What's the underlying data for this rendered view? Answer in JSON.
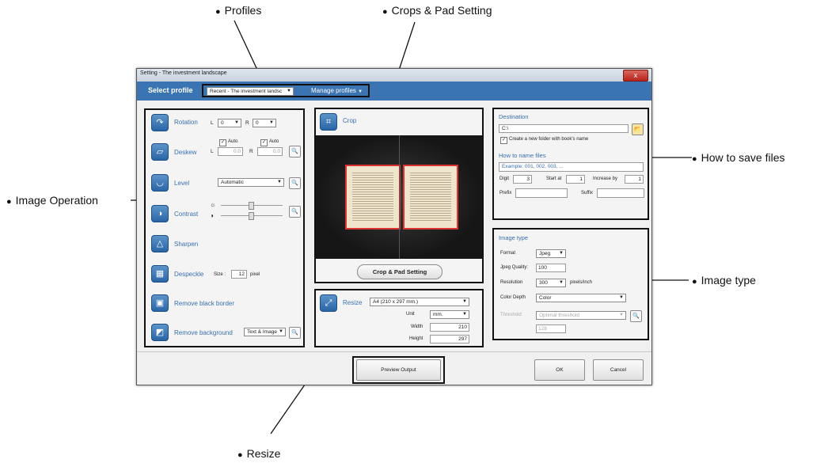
{
  "annotations": {
    "profiles": "Profiles",
    "crops_pad": "Crops & Pad Setting",
    "how_to_save": "How to save files",
    "image_operation": "Image Operation",
    "image_type": "Image type",
    "resize": "Resize"
  },
  "window": {
    "title": "Setting - The investment landscape",
    "close": "x"
  },
  "profile_bar": {
    "label": "Select profile",
    "selected": "Recent - The investment landsc",
    "manage": "Manage profiles"
  },
  "operations": {
    "rotation": {
      "label": "Rotation",
      "l_label": "L",
      "l_value": "0",
      "r_label": "R",
      "r_value": "0"
    },
    "deskew": {
      "label": "Deskew",
      "auto1": "Auto",
      "auto2": "Auto",
      "l_label": "L",
      "l_value": "0.0",
      "r_label": "R",
      "r_value": "0.0"
    },
    "level": {
      "label": "Level",
      "value": "Automatic"
    },
    "contrast": {
      "label": "Contrast"
    },
    "sharpen": {
      "label": "Sharpen"
    },
    "despeckle": {
      "label": "Despeckle",
      "size_label": "Size :",
      "size_value": "12",
      "unit": "pixel"
    },
    "remove_black_border": {
      "label": "Remove black border"
    },
    "remove_background": {
      "label": "Remove background",
      "value": "Text & Image"
    }
  },
  "crop": {
    "label": "Crop",
    "button": "Crop & Pad Setting"
  },
  "resize": {
    "label": "Resize",
    "preset": "A4 (210 x 297 mm.)",
    "unit_label": "Unit",
    "unit_value": "mm.",
    "width_label": "Width",
    "width_value": "210",
    "height_label": "Height",
    "height_value": "297"
  },
  "destination": {
    "title": "Destination",
    "path": "C:\\",
    "checkbox": "Create a new folder with book's name",
    "naming_title": "How to name files",
    "example": "Example: 001, 002, 003, ...",
    "digit_label": "Digit",
    "digit_value": "3",
    "start_label": "Start at",
    "start_value": "1",
    "increase_label": "Increase by",
    "increase_value": "1",
    "prefix_label": "Prefix",
    "suffix_label": "Suffix"
  },
  "image_type": {
    "title": "Image type",
    "format_label": "Format",
    "format_value": "Jpeg",
    "quality_label": "Jpeg Quality:",
    "quality_value": "100",
    "resolution_label": "Resolution",
    "resolution_value": "300",
    "resolution_unit": "pixels/inch",
    "depth_label": "Color Depth",
    "depth_value": "Color",
    "threshold_label": "Threshold",
    "threshold_value": "Optimal threshold",
    "threshold_num": "128"
  },
  "footer": {
    "preview": "Preview Output",
    "ok": "OK",
    "cancel": "Cancel"
  }
}
